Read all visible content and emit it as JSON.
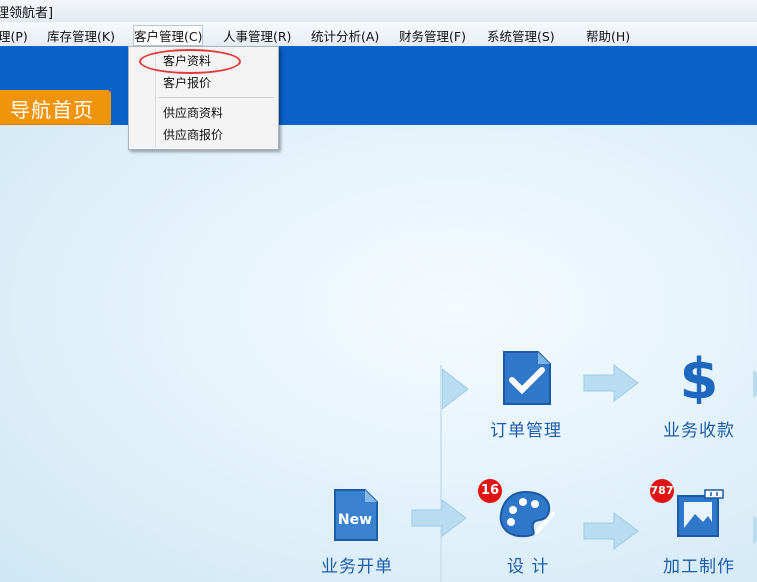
{
  "window": {
    "title": "理领航者]"
  },
  "menubar": {
    "items": [
      {
        "label": "理(P)"
      },
      {
        "label": "库存管理(K)"
      },
      {
        "label": "客户管理(C)"
      },
      {
        "label": "人事管理(R)"
      },
      {
        "label": "统计分析(A)"
      },
      {
        "label": "财务管理(F)"
      },
      {
        "label": "系统管理(S)"
      },
      {
        "label": "帮助(H)"
      }
    ]
  },
  "dropdown": {
    "items": [
      {
        "label": "客户资料"
      },
      {
        "label": "客户报价"
      },
      {
        "label": "供应商资料"
      },
      {
        "label": "供应商报价"
      }
    ]
  },
  "nav_tab": {
    "label": "导航首页"
  },
  "flow": {
    "order_management": "订单管理",
    "business_receipt": "业务收款",
    "new_business": "业务开单",
    "design": "设 计",
    "processing": "加工制作",
    "new_icon_text": "New",
    "design_badge": "16",
    "processing_badge": "787"
  },
  "colors": {
    "menubar_bg": "#e7edf5",
    "blue_bar": "#0a61c8",
    "nav_tab": "#f0940a",
    "label_blue": "#1e5da8",
    "badge_red": "#e01414"
  }
}
